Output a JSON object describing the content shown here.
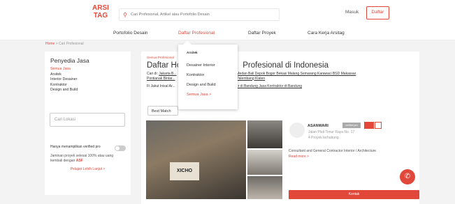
{
  "header": {
    "logo_line1": "ARSI",
    "logo_line2": "TAG",
    "search_placeholder": "Cari Profesional, Artikel atau Portofolio Desain",
    "masuk": "Masuk",
    "daftar": "Daftar"
  },
  "nav": {
    "items": [
      "Portofolio Desain",
      "Daftar Profesional",
      "Daftar Proyek",
      "Cara Kerja Arsitag"
    ]
  },
  "breadcrumb": {
    "home": "Home",
    "sep": " > ",
    "current": "Cari Profesional"
  },
  "sidebar": {
    "title": "Penyedia Jasa",
    "categories": [
      "Semua Jasa",
      "Arsitek",
      "Interior Desainer",
      "Kontraktor",
      "Design and Build"
    ],
    "location_placeholder": "Cari Lokasi",
    "verified_label": "Hanya menampilkan verified pro",
    "guarantee_text": "Jaminan proyek selesai 100% atau uang kembali dengan",
    "guarantee_badge": "ASF",
    "learn_more": "Pelajari Lebih Lanjut >"
  },
  "main": {
    "crumb": "Semua Profesional",
    "title": "Daftar Ho... Profesional di Indonesia",
    "title_part1": "Daftar Ho",
    "title_part2": "Profesional di Indonesia",
    "cities_prefix": "Cari di:",
    "cities_left": "Jakarta  B...",
    "cities_right": "Surakarta  Medan  Bali  Depok  Bogor  Bekasi  Malang  Semarang  Karawaci  BSD  Makassar",
    "cities_line2_left": "Pontianak  Bintar...",
    "cities_line2_right": "Tangerang  Palembang  Klaten",
    "links_left": "Fi Jakut Inisal Ar...",
    "links_right": "Jasa Interior Desainer di Bandung   Jasa Kontraktor di Bandung",
    "sort": "Best Match"
  },
  "card": {
    "image_sign": "XICHO",
    "name": "ASANWARI",
    "badge": "verified pro",
    "address": "Jalan Pluit Timur Raya No. 17",
    "projects": "4 Proyek terhubung",
    "description": "Consultant and General Contractor Interior / Architecture",
    "read_more": "Read more >",
    "contact": "Kontak"
  },
  "dropdown": {
    "header": "Arsitek",
    "items": [
      "Desainer Interior",
      "Kontraktor",
      "Design and Build",
      "Semua Jasa >"
    ]
  }
}
